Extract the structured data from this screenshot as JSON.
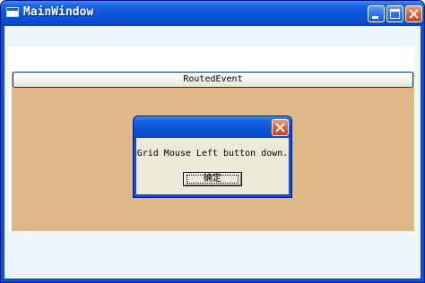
{
  "window": {
    "title": "MainWindow",
    "icons": {
      "app": "window-icon",
      "minimize": "minimize-icon",
      "maximize": "maximize-icon",
      "close": "close-icon"
    }
  },
  "main": {
    "routed_button_label": "RoutedEvent",
    "grid_color": "#deb887"
  },
  "dialog": {
    "message": "Grid Mouse Left button down.",
    "ok_label": "确定"
  }
}
